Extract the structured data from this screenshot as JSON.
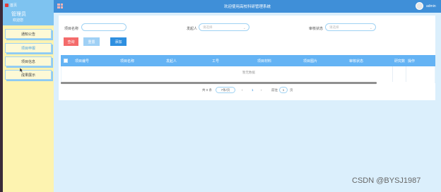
{
  "sidebar": {
    "home_label": "首页",
    "title": "管理员",
    "subtitle": "欢迎您",
    "items": [
      {
        "label": "通知公告"
      },
      {
        "label": "项目申报"
      },
      {
        "label": "项目信息"
      },
      {
        "label": "成果展示"
      }
    ]
  },
  "header": {
    "title": "欢迎使用高校科研管理系统",
    "user": "admin"
  },
  "filters": {
    "name_label": "项目名称",
    "name_value": "",
    "initiator_label": "发起人",
    "initiator_placeholder": "请选择",
    "status_label": "审核状态",
    "status_placeholder": "请选择"
  },
  "actions": {
    "search": "查询",
    "reset": "重置",
    "add": "添加"
  },
  "table": {
    "columns": [
      "项目编号",
      "项目名称",
      "发起人",
      "工号",
      "项目材料",
      "项目图片",
      "审核状态",
      "研究数",
      "操作"
    ],
    "empty_text": "暂无数据"
  },
  "pagination": {
    "total_label": "共 0 条",
    "page_size": "7条/页",
    "current_page": "1",
    "goto_label": "前往",
    "goto_value": "1",
    "page_suffix": "页"
  },
  "watermark": "CSDN @BYSJ1987",
  "colors": {
    "topbar": "#3f8fd8",
    "sidebar": "#fdf3b0",
    "table_header": "#64b3f4",
    "search_button": "#f46b6b",
    "add_button": "#2e8fe0"
  }
}
